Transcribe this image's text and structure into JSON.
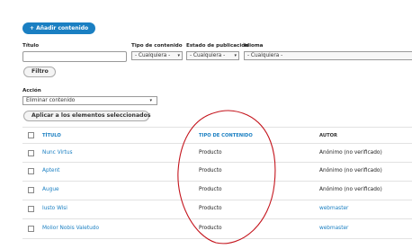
{
  "add_button": "+ Añadir contenido",
  "filters": {
    "title_label": "Título",
    "title_value": "",
    "type_label": "Tipo de contenido",
    "type_value": "- Cualquiera -",
    "status_label": "Estado de publicación",
    "status_value": "- Cualquiera -",
    "language_label": "Idioma",
    "language_value": "- Cualquiera -",
    "filter_button": "Filtro"
  },
  "action": {
    "label": "Acción",
    "selected": "Eliminar contenido",
    "apply_button": "Aplicar a los elementos seleccionados"
  },
  "table": {
    "headers": [
      "TÍTULO",
      "TIPO DE CONTENIDO",
      "AUTOR"
    ],
    "rows": [
      {
        "title": "Nunc Virtus",
        "type": "Producto",
        "author": "Anónimo (no verificado)"
      },
      {
        "title": "Aptent",
        "type": "Producto",
        "author": "Anónimo (no verificado)"
      },
      {
        "title": "Augue",
        "type": "Producto",
        "author": "Anónimo (no verificado)"
      },
      {
        "title": "Iusto Wisi",
        "type": "Producto",
        "author": "webmaster"
      },
      {
        "title": "Molior Nobis Valetudo",
        "type": "Producto",
        "author": "webmaster"
      }
    ]
  },
  "colors": {
    "link": "#1a7fc2",
    "annotation_oval": "#c4141c",
    "header_link": "#1a7fc2"
  }
}
